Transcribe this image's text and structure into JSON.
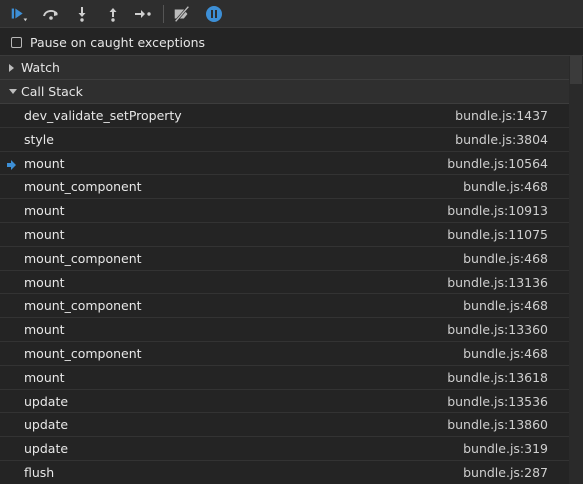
{
  "toolbar": {
    "buttons": [
      {
        "name": "resume-icon"
      },
      {
        "name": "step-over-icon"
      },
      {
        "name": "step-into-icon"
      },
      {
        "name": "step-out-icon"
      },
      {
        "name": "step-icon"
      },
      {
        "name": "deactivate-breakpoints-icon"
      },
      {
        "name": "pause-on-exceptions-icon"
      }
    ],
    "accent_color": "#3d8fd6"
  },
  "pause_on_caught": {
    "label": "Pause on caught exceptions",
    "checked": false
  },
  "watch": {
    "title": "Watch",
    "expanded": false
  },
  "call_stack": {
    "title": "Call Stack",
    "expanded": true,
    "frames": [
      {
        "fn": "dev_validate_setProperty",
        "loc": "bundle.js:1437",
        "current": false
      },
      {
        "fn": "style",
        "loc": "bundle.js:3804",
        "current": false
      },
      {
        "fn": "mount",
        "loc": "bundle.js:10564",
        "current": true
      },
      {
        "fn": "mount_component",
        "loc": "bundle.js:468",
        "current": false
      },
      {
        "fn": "mount",
        "loc": "bundle.js:10913",
        "current": false
      },
      {
        "fn": "mount",
        "loc": "bundle.js:11075",
        "current": false
      },
      {
        "fn": "mount_component",
        "loc": "bundle.js:468",
        "current": false
      },
      {
        "fn": "mount",
        "loc": "bundle.js:13136",
        "current": false
      },
      {
        "fn": "mount_component",
        "loc": "bundle.js:468",
        "current": false
      },
      {
        "fn": "mount",
        "loc": "bundle.js:13360",
        "current": false
      },
      {
        "fn": "mount_component",
        "loc": "bundle.js:468",
        "current": false
      },
      {
        "fn": "mount",
        "loc": "bundle.js:13618",
        "current": false
      },
      {
        "fn": "update",
        "loc": "bundle.js:13536",
        "current": false
      },
      {
        "fn": "update",
        "loc": "bundle.js:13860",
        "current": false
      },
      {
        "fn": "update",
        "loc": "bundle.js:319",
        "current": false
      },
      {
        "fn": "flush",
        "loc": "bundle.js:287",
        "current": false
      }
    ]
  }
}
